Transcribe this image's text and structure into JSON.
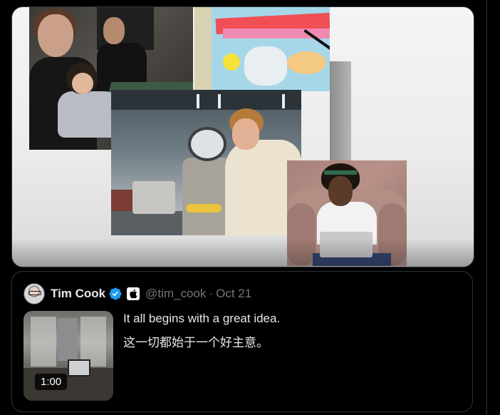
{
  "media": {
    "photos": [
      "family-at-laptop-photo",
      "artwork-photo",
      "wall-photo",
      "workshop-robot-photo",
      "couch-laptop-photo"
    ]
  },
  "quote": {
    "author": {
      "name": "Tim Cook",
      "handle": "@tim_cook",
      "separator": "·",
      "date": "Oct 21",
      "verified_color": "#1d9bf0"
    },
    "text_lines": [
      "It all begins with a great idea.",
      "这一切都始于一个好主意。"
    ],
    "video": {
      "duration": "1:00"
    }
  },
  "colors": {
    "background": "#000000",
    "border": "#2f3336",
    "text_primary": "#e7e9ea",
    "text_secondary": "#71767b",
    "verified_blue": "#1d9bf0"
  }
}
